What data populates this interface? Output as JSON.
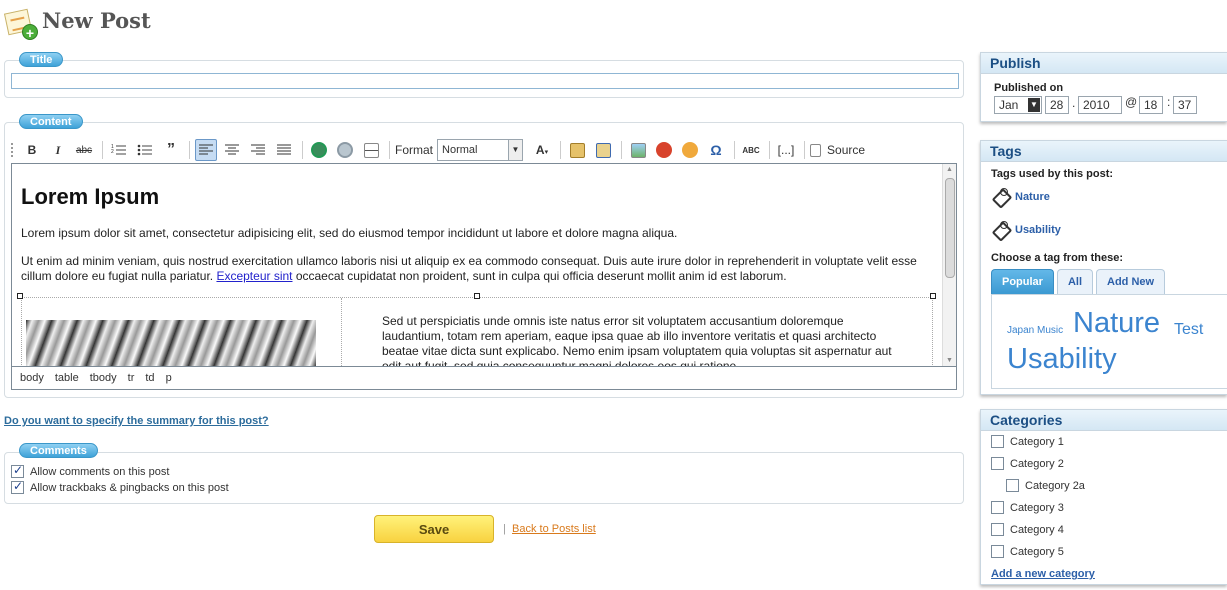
{
  "page": {
    "title": "New Post"
  },
  "title_section": {
    "legend": "Title",
    "value": ""
  },
  "content_section": {
    "legend": "Content",
    "toolbar": {
      "format_label": "Format",
      "format_value": "Normal",
      "source_label": "Source",
      "template_label": "[...]",
      "spell_label": "ABC",
      "bold": "B",
      "italic": "I",
      "strike": "abc"
    },
    "editor": {
      "heading": "Lorem Ipsum",
      "p1": "Lorem ipsum dolor sit amet, consectetur adipisicing elit, sed do eiusmod tempor incididunt ut labore et dolore magna aliqua.",
      "p2_before": "Ut enim ad minim veniam, quis nostrud exercitation ullamco laboris nisi ut aliquip ex ea commodo consequat. Duis aute irure dolor in reprehenderit in voluptate velit esse cillum dolore eu fugiat nulla pariatur. ",
      "p2_link": "Excepteur sint",
      "p2_after": " occaecat cupidatat non proident, sunt in culpa qui officia deserunt mollit anim id est laborum.",
      "col2_text": "Sed ut perspiciatis unde omnis iste natus error sit voluptatem accusantium doloremque laudantium, totam rem aperiam, eaque ipsa quae ab illo inventore veritatis et quasi architecto beatae vitae dicta sunt explicabo. Nemo enim ipsam voluptatem quia voluptas sit aspernatur aut odit aut fugit, sed quia consequuntur magni dolores eos qui ratione"
    },
    "path": [
      "body",
      "table",
      "tbody",
      "tr",
      "td",
      "p"
    ]
  },
  "summary_link": "Do you want to specify the summary for this post?",
  "comments_section": {
    "legend": "Comments",
    "allow_comments": "Allow comments on this post",
    "allow_trackbacks": "Allow trackbaks & pingbacks on this post"
  },
  "actions": {
    "save": "Save",
    "separator": "|",
    "back": "Back to Posts list"
  },
  "publish": {
    "title": "Publish",
    "label": "Published on",
    "month": "Jan",
    "day": "28",
    "dot": ".",
    "year": "2010",
    "at": "@",
    "hour": "18",
    "colon": ":",
    "minute": "37"
  },
  "tags": {
    "title": "Tags",
    "used_label": "Tags used by this post:",
    "used": [
      "Nature",
      "Usability"
    ],
    "choose_label": "Choose a tag from these:",
    "tabs": [
      "Popular",
      "All",
      "Add New"
    ],
    "cloud": {
      "japan": "Japan Music",
      "nature": "Nature",
      "test": "Test",
      "usability": "Usability"
    }
  },
  "categories": {
    "title": "Categories",
    "items": [
      "Category 1",
      "Category 2",
      "Category 2a",
      "Category 3",
      "Category 4",
      "Category 5"
    ],
    "add": "Add a new category"
  },
  "colors": {
    "accent": "#3ea2d8",
    "link": "#2c5fa8",
    "save": "#f8d240"
  }
}
